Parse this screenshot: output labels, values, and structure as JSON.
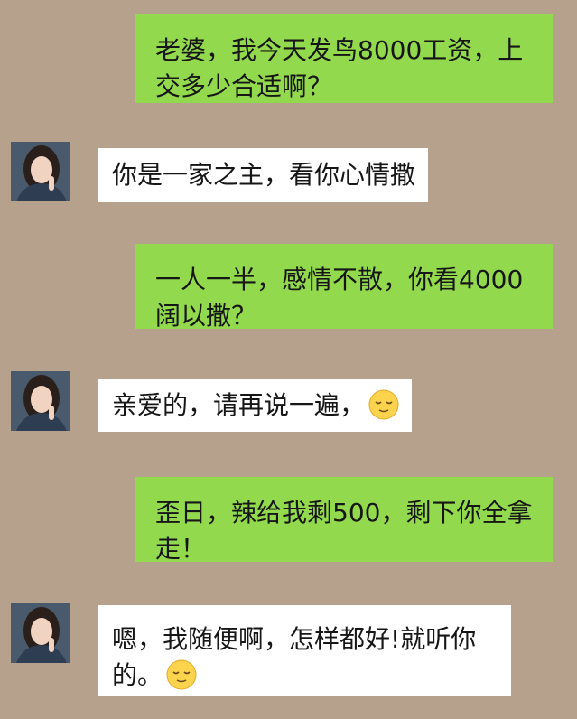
{
  "colors": {
    "background": "#b5a18c",
    "outgoing_bubble": "#93d94d",
    "incoming_bubble": "#ffffff",
    "text": "#161616"
  },
  "messages": [
    {
      "sender": "me",
      "text": "老婆，我今天发鸟8000工资，上交多少合适啊？",
      "emoji": null
    },
    {
      "sender": "wife",
      "text": "你是一家之主，看你心情撒",
      "emoji": null
    },
    {
      "sender": "me",
      "text": "一人一半，感情不散，你看4000阔以撒？",
      "emoji": null
    },
    {
      "sender": "wife",
      "text": "亲爱的，请再说一遍，",
      "emoji": "relieved-face"
    },
    {
      "sender": "me",
      "text": "歪日，辣给我剩500，剩下你全拿走！",
      "emoji": null
    },
    {
      "sender": "wife",
      "text": "嗯，我随便啊，怎样都好!就听你的。",
      "emoji": "relieved-face"
    }
  ]
}
